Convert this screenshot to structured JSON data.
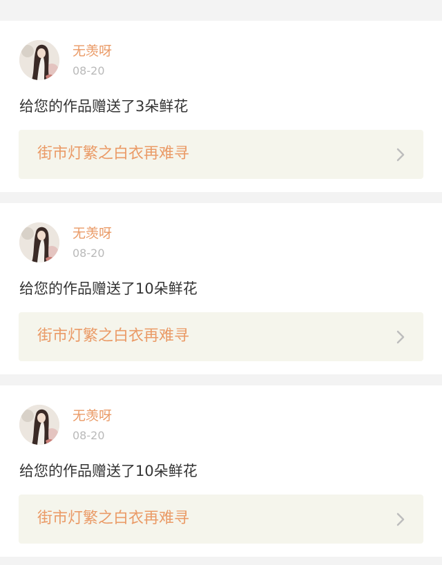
{
  "feed": {
    "items": [
      {
        "user": "无羡呀",
        "date": "08-20",
        "message": "给您的作品赠送了3朵鲜花",
        "work_title": "街市灯繁之白衣再难寻",
        "avatar_icon": "user-avatar-portrait",
        "chevron_icon": "chevron-right"
      },
      {
        "user": "无羡呀",
        "date": "08-20",
        "message": "给您的作品赠送了10朵鲜花",
        "work_title": "街市灯繁之白衣再难寻",
        "avatar_icon": "user-avatar-portrait",
        "chevron_icon": "chevron-right"
      },
      {
        "user": "无羡呀",
        "date": "08-20",
        "message": "给您的作品赠送了10朵鲜花",
        "work_title": "街市灯繁之白衣再难寻",
        "avatar_icon": "user-avatar-portrait",
        "chevron_icon": "chevron-right"
      }
    ]
  },
  "colors": {
    "accent": "#ea9a66",
    "date": "#b9b9b9",
    "text": "#333333",
    "link_bg": "#f5f5ec",
    "page_bg": "#f3f3f3"
  }
}
